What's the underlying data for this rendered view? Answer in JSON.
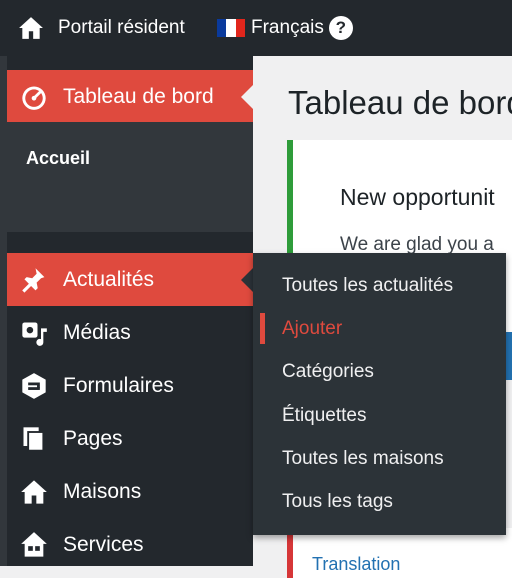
{
  "topbar": {
    "home_label": "Portail résident",
    "language_label": "Français",
    "help_label": "?",
    "flag_colors": [
      "#0a3a9c",
      "#ffffff",
      "#e1261c"
    ]
  },
  "sidebar": {
    "dashboard_label": "Tableau de bord",
    "sub_accueil": "Accueil",
    "items": [
      {
        "label": "Actualités",
        "icon": "pin-icon"
      },
      {
        "label": "Médias",
        "icon": "media-icon"
      },
      {
        "label": "Formulaires",
        "icon": "forms-icon"
      },
      {
        "label": "Pages",
        "icon": "pages-icon"
      },
      {
        "label": "Maisons",
        "icon": "house-icon"
      },
      {
        "label": "Services",
        "icon": "services-icon"
      }
    ]
  },
  "flyout": {
    "items": [
      {
        "label": "Toutes les actualités"
      },
      {
        "label": "Ajouter"
      },
      {
        "label": "Catégories"
      },
      {
        "label": "Étiquettes"
      },
      {
        "label": "Toutes les maisons"
      },
      {
        "label": "Tous les tags"
      }
    ],
    "current_index": 1
  },
  "main": {
    "page_title": "Tableau de bord",
    "notice_title": "New opportunit",
    "notice_text": "We are glad you a",
    "translation_link": "Translation"
  },
  "colors": {
    "accent": "#df4a3e",
    "sidebar_bg": "#23282d",
    "flyout_bg": "#2c3338",
    "notice_border": "#2e9c3a"
  }
}
